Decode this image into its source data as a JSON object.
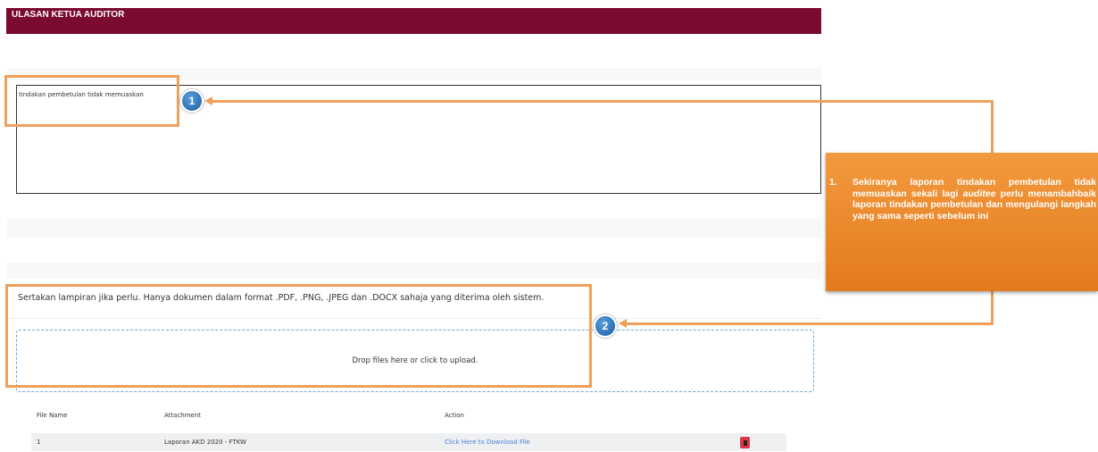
{
  "header": {
    "title": "ULASAN KETUA AUDITOR"
  },
  "review": {
    "text": "tindakan pembetulan tidak memuaskan"
  },
  "attachments": {
    "instruction": "Sertakan lampiran jika perlu. Hanya dokumen dalam format .PDF, .PNG, .JPEG dan .DOCX sahaja yang diterima oleh sistem.",
    "dropzone_label": "Drop files here or click to upload."
  },
  "table": {
    "columns": [
      "File Name",
      "Attachment",
      "Action"
    ],
    "rows": [
      {
        "file_name": "1",
        "attachment": "Laporan AKD 2020 - FTKW",
        "action": "Click Here to Download File"
      }
    ]
  },
  "annotations": {
    "marker_1": "1",
    "marker_2": "2",
    "callout_number": "1.",
    "callout_text_before": "Sekiranya laporan tindakan pembetulan tidak memuaskan sekali lagi ",
    "callout_text_italic": "auditee",
    "callout_text_after": " perlu menambahbaik laporan tindakan pembetulan dan mengulangi langkah yang sama seperti sebelum ini"
  },
  "colors": {
    "header_bg": "#7a0a2e",
    "highlight": "#f0a05a",
    "callout_bg": "#e8862a",
    "marker": "#2b6fb5",
    "link": "#4a7fd6",
    "delete": "#dc3545"
  },
  "icons": {
    "delete": "trash-icon"
  }
}
